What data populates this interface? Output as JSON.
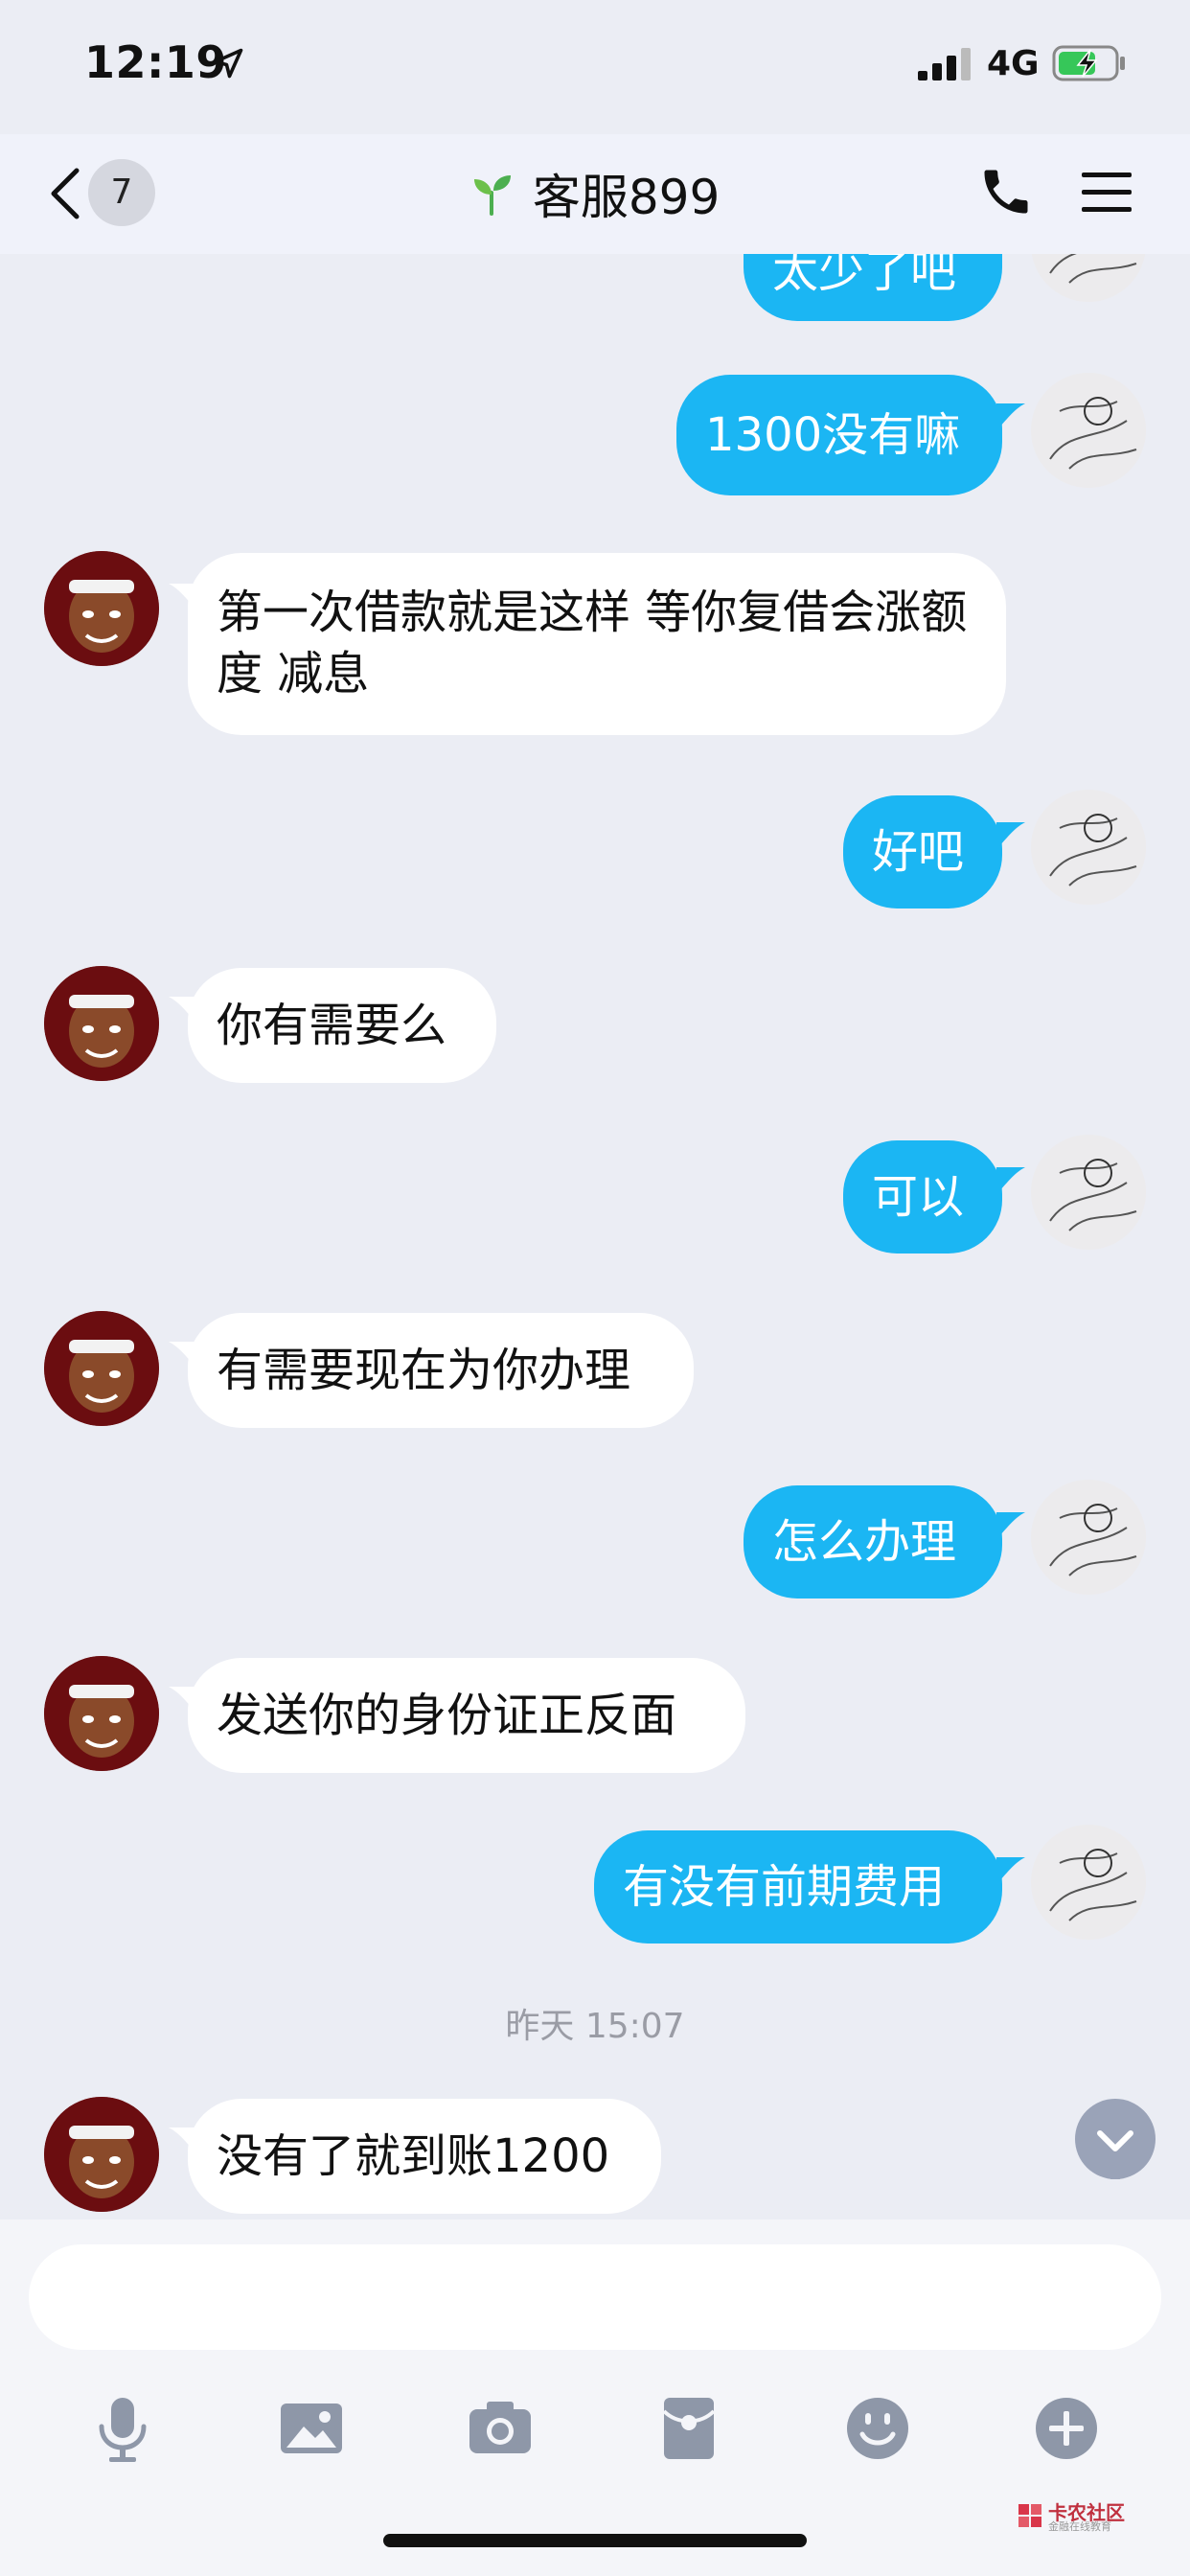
{
  "status_bar": {
    "time": "12:19",
    "network": "4G"
  },
  "header": {
    "unread_count": "7",
    "title": "客服899"
  },
  "messages": [
    {
      "side": "out",
      "text": "太少了吧"
    },
    {
      "side": "out",
      "text": "1300没有嘛"
    },
    {
      "side": "in",
      "text": "第一次借款就是这样 等你复借会涨额度 减息"
    },
    {
      "side": "out",
      "text": "好吧"
    },
    {
      "side": "in",
      "text": "你有需要么"
    },
    {
      "side": "out",
      "text": "可以"
    },
    {
      "side": "in",
      "text": "有需要现在为你办理"
    },
    {
      "side": "out",
      "text": "怎么办理"
    },
    {
      "side": "in",
      "text": "发送你的身份证正反面"
    },
    {
      "side": "out",
      "text": "有没有前期费用"
    },
    {
      "side": "in",
      "text": "没有了就到账1200"
    }
  ],
  "timestamp": "昨天 15:07",
  "input": {
    "value": "",
    "placeholder": ""
  },
  "toolbar": [
    "microphone-icon",
    "image-icon",
    "camera-icon",
    "red-packet-icon",
    "emoji-icon",
    "plus-icon"
  ],
  "watermark": {
    "title": "卡农社区",
    "subtitle": "金融在线教育"
  },
  "colors": {
    "accent": "#1bb6f3",
    "background": "#ebedf4",
    "incoming_bubble": "#ffffff"
  }
}
